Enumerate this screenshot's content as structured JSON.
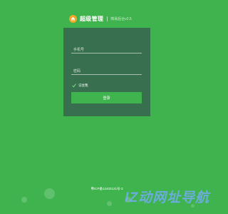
{
  "header": {
    "app_title": "超级管理",
    "app_subtitle": "简易后台v2.5",
    "logo_icon": "house-icon",
    "logo_color": "#f5a623"
  },
  "login": {
    "phone_placeholder": "手机号",
    "password_placeholder": "密码",
    "remember_label": "记住我",
    "remember_checked": true,
    "submit_label": "登录"
  },
  "footer": {
    "icp_text": "粤ICP备12402121号-3"
  },
  "watermark": {
    "text": "IZ动网址导航"
  },
  "colors": {
    "background": "#3fb34d",
    "panel": "#38704f",
    "button": "#3fb34d"
  }
}
